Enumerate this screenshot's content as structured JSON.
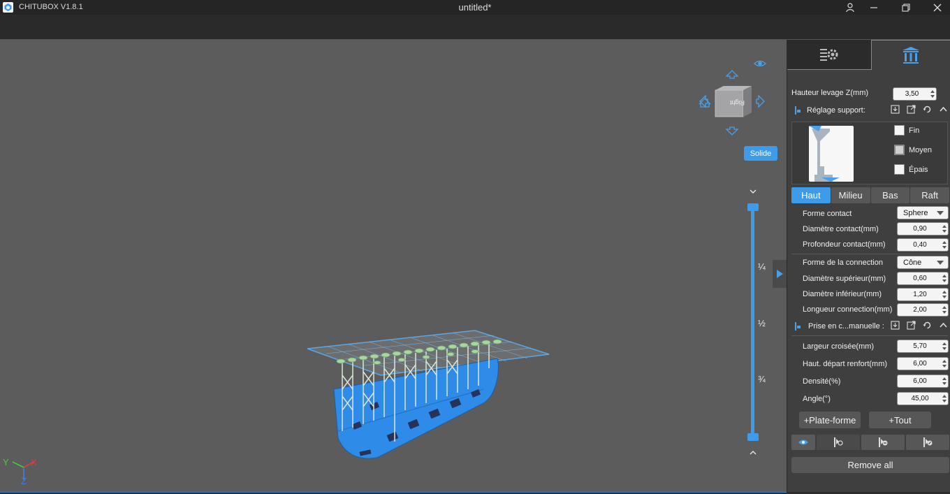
{
  "titlebar": {
    "app_title": "CHITUBOX V1.8.1",
    "doc_title": "untitled*"
  },
  "viewport": {
    "view_cube_label": "Right",
    "render_mode_button": "Solide",
    "slider_labels": [
      "¼",
      "½",
      "¾"
    ],
    "axes": {
      "x": "X",
      "y": "Y",
      "z": "Z"
    }
  },
  "panel": {
    "lift_height": {
      "label": "Hauteur levage Z(mm)",
      "value": "3,50"
    },
    "support_settings": {
      "label": "Réglage support:",
      "presets": [
        "Fin",
        "Moyen",
        "Épais"
      ],
      "tabs": [
        "Haut",
        "Milieu",
        "Bas",
        "Raft"
      ],
      "active_tab": "Haut",
      "rows": [
        {
          "label": "Forme contact",
          "type": "select",
          "value": "Sphere"
        },
        {
          "label": "Diamètre contact(mm)",
          "type": "spin",
          "value": "0,90"
        },
        {
          "label": "Profondeur contact(mm)",
          "type": "spin",
          "value": "0,40"
        },
        {
          "label": "Forme de la connection",
          "type": "select",
          "value": "Cône"
        },
        {
          "label": "Diamètre supérieur(mm)",
          "type": "spin",
          "value": "0,60"
        },
        {
          "label": "Diamètre inférieur(mm)",
          "type": "spin",
          "value": "1,20"
        },
        {
          "label": "Longueur connection(mm)",
          "type": "spin",
          "value": "2,00"
        }
      ]
    },
    "manual_grip": {
      "label": "Prise en c...manuelle :",
      "rows": [
        {
          "label": "Largeur croisée(mm)",
          "value": "5,70"
        },
        {
          "label": "Haut. départ renfort(mm)",
          "value": "6,00"
        },
        {
          "label": "Densité(%)",
          "value": "6,00"
        },
        {
          "label": "Angle(°)",
          "value": "45,00"
        }
      ]
    },
    "buttons": {
      "platform": "+Plate-forme",
      "all": "+Tout",
      "remove_all": "Remove all"
    }
  },
  "colors": {
    "accent": "#3d9be9",
    "viewport": "#5c5c5d",
    "panel": "#3f3f40",
    "model": "#2f8be8"
  }
}
